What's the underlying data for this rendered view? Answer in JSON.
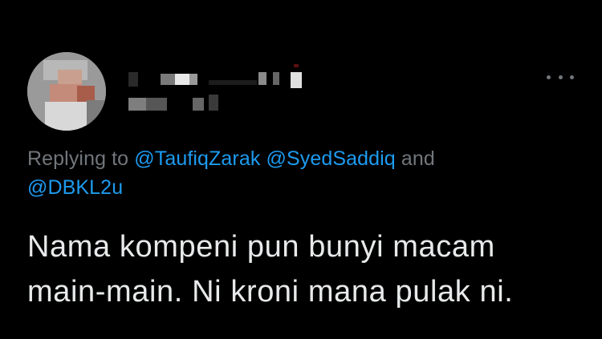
{
  "header": {
    "avatar_icon": "blurred-avatar",
    "display_name": "",
    "more_icon": "more-horizontal-icon"
  },
  "reply": {
    "prefix": "Replying to",
    "mention_1": "@TaufiqZarak",
    "mention_2": "@SyedSaddiq",
    "conjunction": "and",
    "mention_3": "@DBKL2u"
  },
  "tweet": {
    "line_1": "Nama kompeni pun bunyi macam",
    "line_2": "main-main. Ni kroni mana pulak ni."
  },
  "colors": {
    "background": "#000000",
    "text": "#e7e9ea",
    "muted": "#71767b",
    "link": "#1d9bf0"
  }
}
